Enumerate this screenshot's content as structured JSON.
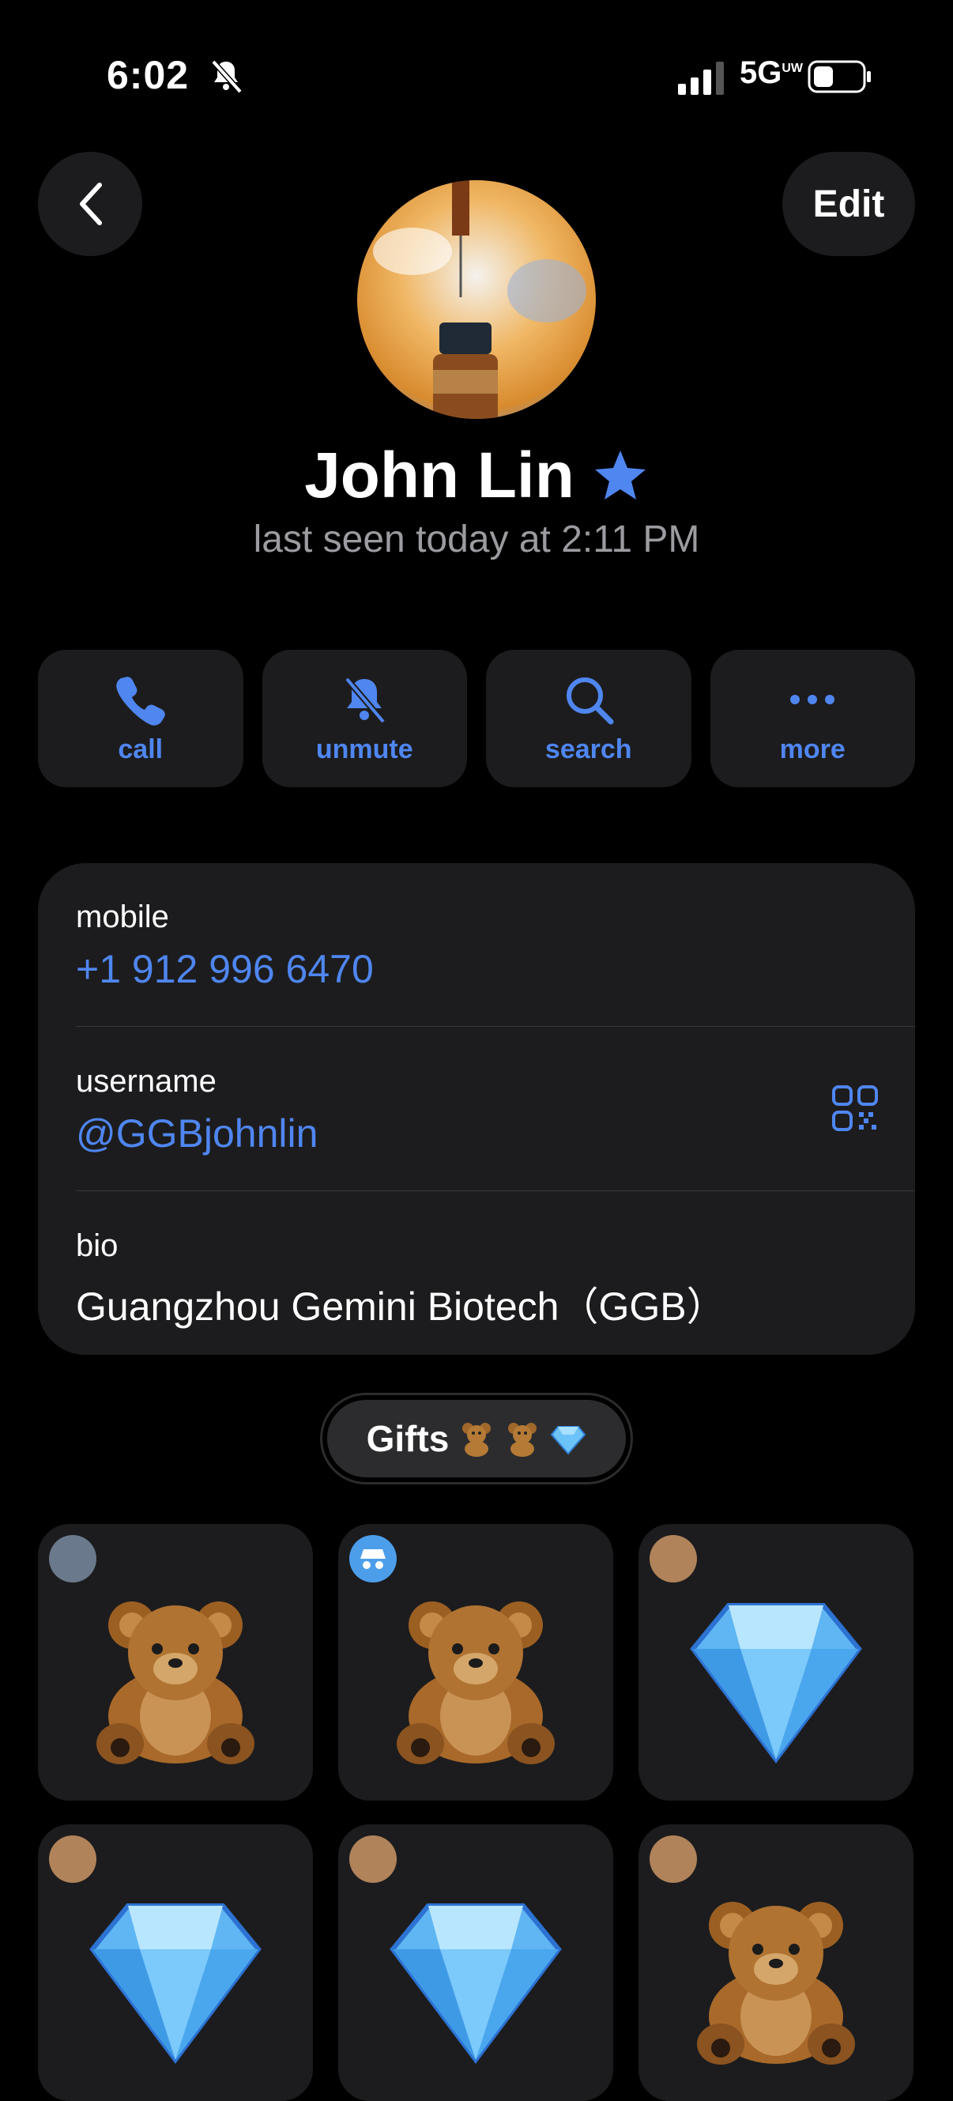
{
  "status_bar": {
    "time": "6:02",
    "network": "5G"
  },
  "header": {
    "edit_label": "Edit"
  },
  "profile": {
    "name": "John Lin",
    "last_seen": "last seen today at 2:11 PM"
  },
  "actions": [
    {
      "label": "call",
      "icon": "phone-icon"
    },
    {
      "label": "unmute",
      "icon": "bell-off-icon"
    },
    {
      "label": "search",
      "icon": "search-icon"
    },
    {
      "label": "more",
      "icon": "more-icon"
    }
  ],
  "info": {
    "mobile_label": "mobile",
    "mobile_value": "+1 912 996 6470",
    "username_label": "username",
    "username_value": "@GGBjohnlin",
    "bio_label": "bio",
    "bio_value": "Guangzhou Gemini Biotech（GGB）"
  },
  "gifts": {
    "label": "Gifts",
    "tiles": [
      {
        "type": "teddy-bear",
        "badge": "avatar"
      },
      {
        "type": "teddy-bear",
        "badge": "incognito"
      },
      {
        "type": "diamond",
        "badge": "avatar"
      },
      {
        "type": "diamond",
        "badge": "avatar"
      },
      {
        "type": "diamond",
        "badge": "avatar"
      },
      {
        "type": "teddy-bear",
        "badge": "avatar"
      }
    ]
  },
  "colors": {
    "accent": "#4f86f0",
    "card": "#1c1c1e",
    "background": "#000000"
  }
}
